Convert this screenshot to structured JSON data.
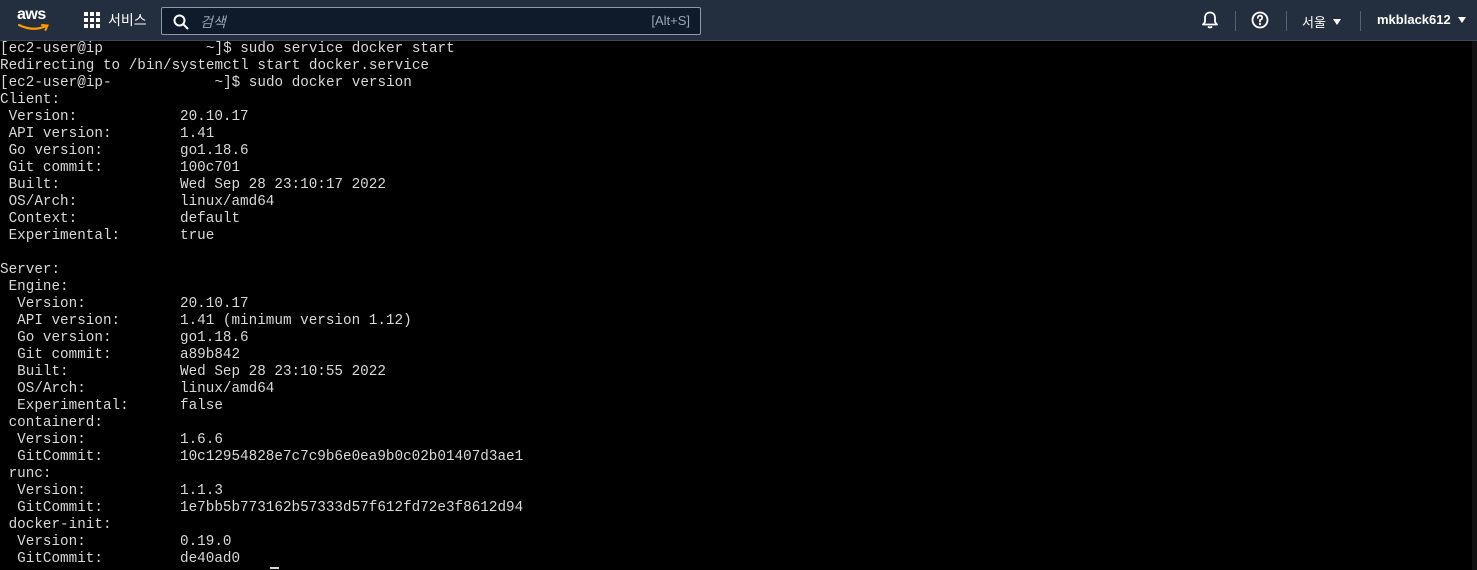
{
  "topbar": {
    "logo": "aws",
    "services_label": "서비스",
    "search_placeholder": "검색",
    "search_shortcut": "[Alt+S]",
    "icons": [
      "grid-icon",
      "search-icon",
      "bell-icon",
      "help-icon",
      "caret-down-icon"
    ],
    "region_label": "서울",
    "account_label": "mkblack612"
  },
  "terminal": {
    "lines": [
      {
        "text": "[ec2-user@ip            ~]$ sudo service docker start",
        "value": ""
      },
      {
        "text": "Redirecting to /bin/systemctl start docker.service",
        "value": ""
      },
      {
        "text": "[ec2-user@ip-            ~]$ sudo docker version",
        "value": ""
      },
      {
        "text": "Client:",
        "value": ""
      },
      {
        "text": " Version:",
        "value": "20.10.17"
      },
      {
        "text": " API version:",
        "value": "1.41"
      },
      {
        "text": " Go version:",
        "value": "go1.18.6"
      },
      {
        "text": " Git commit:",
        "value": "100c701"
      },
      {
        "text": " Built:",
        "value": "Wed Sep 28 23:10:17 2022"
      },
      {
        "text": " OS/Arch:",
        "value": "linux/amd64"
      },
      {
        "text": " Context:",
        "value": "default"
      },
      {
        "text": " Experimental:",
        "value": "true"
      },
      {
        "text": "",
        "value": ""
      },
      {
        "text": "Server:",
        "value": ""
      },
      {
        "text": " Engine:",
        "value": ""
      },
      {
        "text": "  Version:",
        "value": "20.10.17"
      },
      {
        "text": "  API version:",
        "value": "1.41 (minimum version 1.12)"
      },
      {
        "text": "  Go version:",
        "value": "go1.18.6"
      },
      {
        "text": "  Git commit:",
        "value": "a89b842"
      },
      {
        "text": "  Built:",
        "value": "Wed Sep 28 23:10:55 2022"
      },
      {
        "text": "  OS/Arch:",
        "value": "linux/amd64"
      },
      {
        "text": "  Experimental:",
        "value": "false"
      },
      {
        "text": " containerd:",
        "value": ""
      },
      {
        "text": "  Version:",
        "value": "1.6.6"
      },
      {
        "text": "  GitCommit:",
        "value": "10c12954828e7c7c9b6e0ea9b0c02b01407d3ae1"
      },
      {
        "text": " runc:",
        "value": ""
      },
      {
        "text": "  Version:",
        "value": "1.1.3"
      },
      {
        "text": "  GitCommit:",
        "value": "1e7bb5b773162b57333d57f612fd72e3f8612d94"
      },
      {
        "text": " docker-init:",
        "value": ""
      },
      {
        "text": "  Version:",
        "value": "0.19.0"
      },
      {
        "text": "  GitCommit:",
        "value": "de40ad0"
      }
    ]
  }
}
